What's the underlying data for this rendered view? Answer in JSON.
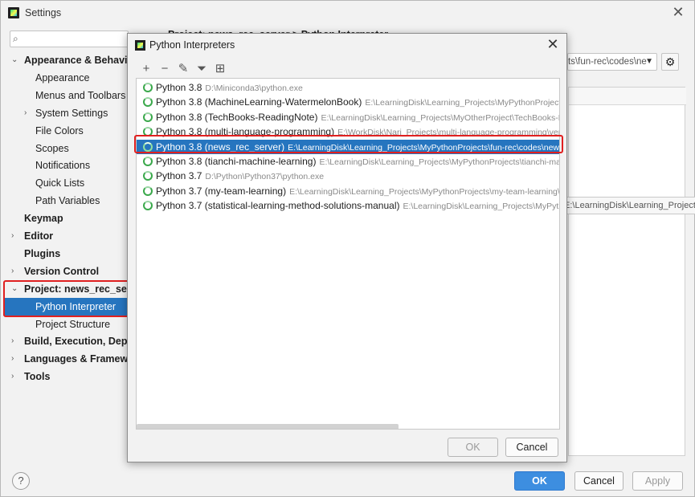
{
  "settings": {
    "title": "Settings",
    "breadcrumb": "Project: news_rec_server  >  Python Interpreter",
    "interpreter_combo_value": "ts\\fun-rec\\codes\\ne",
    "tooltip_fragment": "E:\\LearningDisk\\Learning_Projects\\MyPythonProjects\\statistical-learning-method-sol",
    "sidebar": [
      {
        "label": "Appearance & Behavior",
        "bold": true,
        "expanded": true,
        "level": 0
      },
      {
        "label": "Appearance",
        "level": 1
      },
      {
        "label": "Menus and Toolbars",
        "level": 1
      },
      {
        "label": "System Settings",
        "level": 1,
        "collapsed": true
      },
      {
        "label": "File Colors",
        "level": 1
      },
      {
        "label": "Scopes",
        "level": 1
      },
      {
        "label": "Notifications",
        "level": 1
      },
      {
        "label": "Quick Lists",
        "level": 1
      },
      {
        "label": "Path Variables",
        "level": 1
      },
      {
        "label": "Keymap",
        "bold": true,
        "level": 0
      },
      {
        "label": "Editor",
        "bold": true,
        "level": 0,
        "collapsed": true
      },
      {
        "label": "Plugins",
        "bold": true,
        "level": 0
      },
      {
        "label": "Version Control",
        "bold": true,
        "level": 0,
        "collapsed": true
      },
      {
        "label": "Project: news_rec_server",
        "bold": true,
        "level": 0,
        "expanded": true
      },
      {
        "label": "Python Interpreter",
        "level": 1,
        "selected": true
      },
      {
        "label": "Project Structure",
        "level": 1
      },
      {
        "label": "Build, Execution, Deployment",
        "bold": true,
        "level": 0,
        "collapsed": true
      },
      {
        "label": "Languages & Frameworks",
        "bold": true,
        "level": 0,
        "collapsed": true
      },
      {
        "label": "Tools",
        "bold": true,
        "level": 0,
        "collapsed": true
      }
    ],
    "buttons": {
      "ok": "OK",
      "cancel": "Cancel",
      "apply": "Apply",
      "help": "?"
    }
  },
  "dialog": {
    "title": "Python Interpreters",
    "toolbar": [
      {
        "name": "add-icon",
        "glyph": "+"
      },
      {
        "name": "remove-icon",
        "glyph": "−"
      },
      {
        "name": "edit-icon",
        "glyph": "✎"
      },
      {
        "name": "filter-icon",
        "glyph": "⏷"
      },
      {
        "name": "paths-icon",
        "glyph": "⊞"
      }
    ],
    "interpreters": [
      {
        "name": "Python 3.8",
        "path": "D:\\Miniconda3\\python.exe"
      },
      {
        "name": "Python 3.8 (MachineLearning-WatermelonBook)",
        "path": "E:\\LearningDisk\\Learning_Projects\\MyPythonProjects\\Mac"
      },
      {
        "name": "Python 3.8 (TechBooks-ReadingNote)",
        "path": "E:\\LearningDisk\\Learning_Projects\\MyOtherProject\\TechBooks-Readin"
      },
      {
        "name": "Python 3.8 (multi-language-programming)",
        "path": "E:\\WorkDisk\\Nari_Projects\\multi-language-programming\\veny\\"
      },
      {
        "name": "Python 3.8 (news_rec_server)",
        "path": "E:\\LearningDisk\\Learning_Projects\\MyPythonProjects\\fun-rec\\codes\\news_recsy",
        "selected": true
      },
      {
        "name": "Python 3.8 (tianchi-machine-learning)",
        "path": "E:\\LearningDisk\\Learning_Projects\\MyPythonProjects\\tianchi-machine"
      },
      {
        "name": "Python 3.7",
        "path": "D:\\Python\\Python37\\python.exe"
      },
      {
        "name": "Python 3.7 (my-team-learning)",
        "path": "E:\\LearningDisk\\Learning_Projects\\MyPythonProjects\\my-team-learning\\venv"
      },
      {
        "name": "Python 3.7 (statistical-learning-method-solutions-manual)",
        "path": "E:\\LearningDisk\\Learning_Projects\\MyPythonProjects\\statistical-learning-method-sol"
      }
    ],
    "buttons": {
      "ok": "OK",
      "cancel": "Cancel"
    }
  },
  "colors": {
    "selection": "#2675bf",
    "highlight_border": "#e02020",
    "ok_button": "#3d8ee0"
  }
}
